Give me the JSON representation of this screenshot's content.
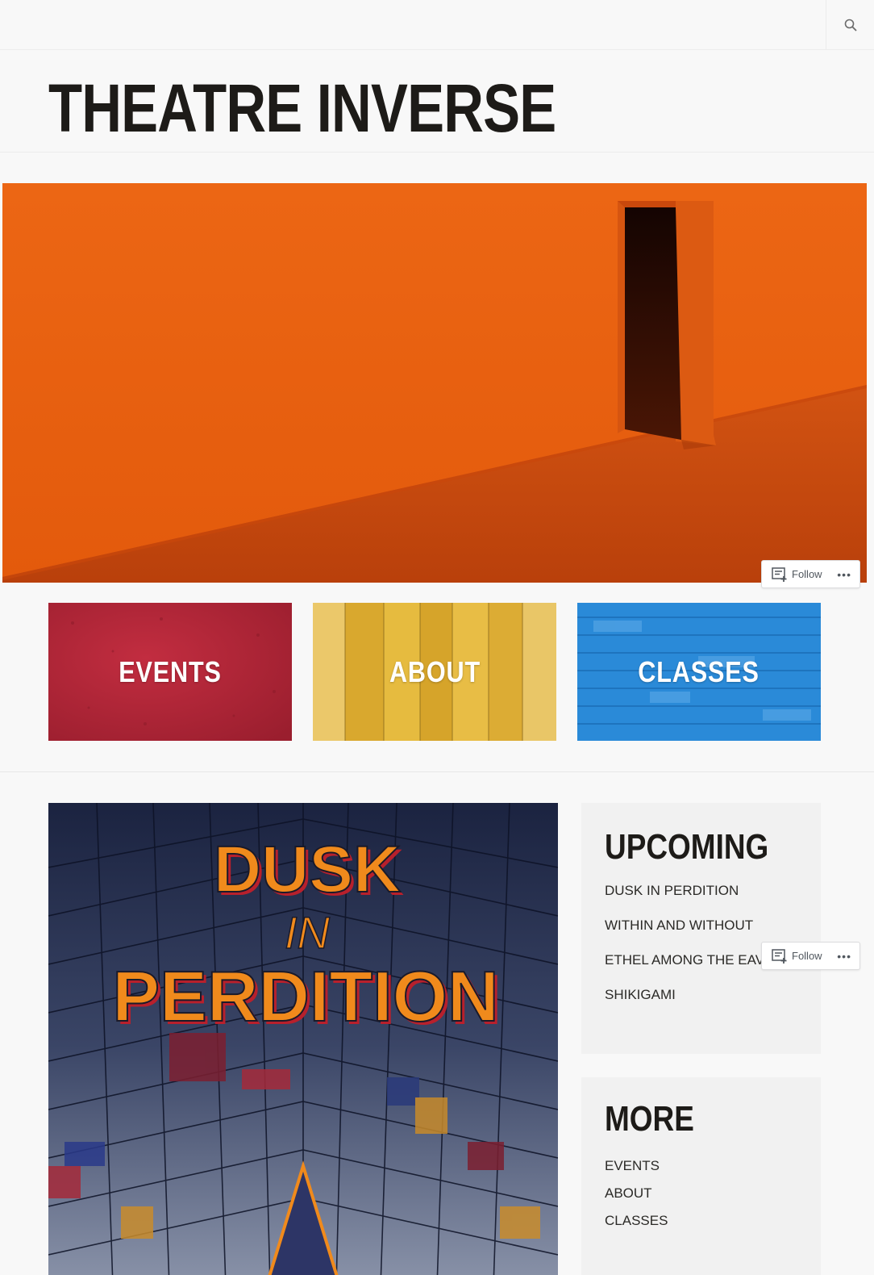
{
  "header": {
    "search_icon": "search-icon"
  },
  "site": {
    "title": "THEATRE INVERSE"
  },
  "follow": {
    "label": "Follow",
    "more": "•••",
    "icon": "reader-follow-icon"
  },
  "tiles": [
    {
      "label": "EVENTS",
      "color": "#b3283a"
    },
    {
      "label": "ABOUT",
      "color": "#e1b53a"
    },
    {
      "label": "CLASSES",
      "color": "#2483d4"
    }
  ],
  "poster": {
    "line1": "DUSK",
    "line2": "IN",
    "line3": "PERDITION"
  },
  "upcoming": {
    "title": "UPCOMING",
    "items": [
      "DUSK IN PERDITION",
      "WITHIN AND WITHOUT",
      "ETHEL AMONG THE EAVES",
      "SHIKIGAMI"
    ]
  },
  "more": {
    "title": "MORE",
    "items": [
      "EVENTS",
      "ABOUT",
      "CLASSES"
    ]
  },
  "colors": {
    "hero_orange": "#e8621a",
    "poster_orange": "#f08a1c",
    "poster_navy": "#1d2440"
  }
}
